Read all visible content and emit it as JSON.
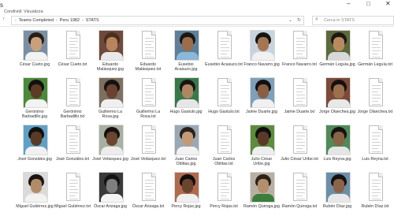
{
  "window": {
    "menu": [
      "Condividi",
      "Visualizza"
    ],
    "controls": [
      "–",
      "□",
      "✕"
    ]
  },
  "address": {
    "crumbs": [
      "Teams Completed",
      "Peru 1982",
      "STATS"
    ],
    "search_placeholder": "Cerca in STATS"
  },
  "files": [
    {
      "label": "César Cueto.jpg",
      "type": "photo",
      "skin": "#c9a07a",
      "hair": "#2a1e16",
      "shirt": "#f2f2f2",
      "bg": "#7a8fa3"
    },
    {
      "label": "César Cueto.txt",
      "type": "txt"
    },
    {
      "label": "Eduardo Malásquez.jpg",
      "type": "photo",
      "skin": "#b8845e",
      "hair": "#4a2e1e",
      "shirt": "#e9e9e9",
      "bg": "#6d4a3c"
    },
    {
      "label": "Eduardo Malásquez.txt",
      "type": "txt"
    },
    {
      "label": "Eusebio Acasuzo.jpg",
      "type": "photo",
      "skin": "#9b6d4c",
      "hair": "#1b1714",
      "shirt": "#8bb7d8",
      "bg": "#5d7f9a"
    },
    {
      "label": "Eusebio Acasuzo.txt",
      "type": "txt"
    },
    {
      "label": "Franco Navarro.jpg",
      "type": "photo",
      "skin": "#a57652",
      "hair": "#141414",
      "shirt": "#f1f1f1",
      "bg": "#c7d3dd"
    },
    {
      "label": "Franco Navarro.txt",
      "type": "txt"
    },
    {
      "label": "Germán Leguía.jpg",
      "type": "photo",
      "skin": "#b88a5f",
      "hair": "#1d1812",
      "shirt": "#d8d8d8",
      "bg": "#5b6a3b"
    },
    {
      "label": "Germán Leguía.txt",
      "type": "txt"
    },
    {
      "label": "Gerónimo Barbadillo.jpg",
      "type": "photo",
      "skin": "#5e3b26",
      "hair": "#141010",
      "shirt": "#f3f3f3",
      "bg": "#4a8a38"
    },
    {
      "label": "Gerónimo Barbadillo.txt",
      "type": "txt"
    },
    {
      "label": "Guillermo La Rosa.jpg",
      "type": "photo",
      "skin": "#6a4330",
      "hair": "#161211",
      "shirt": "#efefef",
      "bg": "#7e705f"
    },
    {
      "label": "Guillermo La Rosa.txt",
      "type": "txt"
    },
    {
      "label": "Hugo Gastulo.jpg",
      "type": "photo",
      "skin": "#b08563",
      "hair": "#1a1512",
      "shirt": "#e6e6e6",
      "bg": "#38794a"
    },
    {
      "label": "Hugo Gastulo.txt",
      "type": "txt"
    },
    {
      "label": "Jaime Duarte.jpg",
      "type": "photo",
      "skin": "#8a5e42",
      "hair": "#121010",
      "shirt": "#f0f0f0",
      "bg": "#7ea0b8"
    },
    {
      "label": "Jaime Duarte.txt",
      "type": "txt"
    },
    {
      "label": "Jorge Olaechea.jpg",
      "type": "photo",
      "skin": "#9c6f4d",
      "hair": "#151110",
      "shirt": "#e8e8e8",
      "bg": "#7d4a3a"
    },
    {
      "label": "Jorge Olaechea.txt",
      "type": "txt"
    },
    {
      "label": "José Gonzáles.jpg",
      "type": "photo",
      "skin": "#5a3a26",
      "hair": "#121010",
      "shirt": "#f1f1f1",
      "bg": "#5fa0c6"
    },
    {
      "label": "José Gonzáles.txt",
      "type": "txt"
    },
    {
      "label": "José Velásquez.jpg",
      "type": "photo",
      "skin": "#6b4530",
      "hair": "#141110",
      "shirt": "#ececec",
      "bg": "#a8b0a2"
    },
    {
      "label": "José Velásquez.txt",
      "type": "txt"
    },
    {
      "label": "Juan Carlos Oblitas.jpg",
      "type": "photo",
      "skin": "#c29a78",
      "hair": "#2a211b",
      "shirt": "#f2f2f2",
      "bg": "#9aa8b4"
    },
    {
      "label": "Juan Carlos Oblitas.txt",
      "type": "txt"
    },
    {
      "label": "Julio César Uribe.jpg",
      "type": "photo",
      "skin": "#5b3b28",
      "hair": "#101010",
      "shirt": "#eeeeee",
      "bg": "#5d8c3e"
    },
    {
      "label": "Julio César Uribe.txt",
      "type": "txt"
    },
    {
      "label": "Luis Reyna.jpg",
      "type": "photo",
      "skin": "#8a6246",
      "hair": "#151211",
      "shirt": "#e5e5e5",
      "bg": "#4f8a58"
    },
    {
      "label": "Luis Reyna.txt",
      "type": "txt"
    },
    {
      "label": "Miguel Gutiérrez.jpg",
      "type": "photo",
      "skin": "#b28b68",
      "hair": "#1b1613",
      "shirt": "#f2f2f2",
      "bg": "#dadada"
    },
    {
      "label": "Miguel Gutiérrez.txt",
      "type": "txt"
    },
    {
      "label": "Óscar Arizaga.jpg",
      "type": "photo",
      "skin": "#7e7e7e",
      "hair": "#141414",
      "shirt": "#f4f4f4",
      "bg": "#3a3a3a"
    },
    {
      "label": "Óscar Arizaga.txt",
      "type": "txt"
    },
    {
      "label": "Percy Rojas.jpg",
      "type": "photo",
      "skin": "#6b4430",
      "hair": "#120f0e",
      "shirt": "#efefef",
      "bg": "#b06a4d"
    },
    {
      "label": "Percy Rojas.txt",
      "type": "txt"
    },
    {
      "label": "Ramón Quiroga.jpg",
      "type": "photo",
      "skin": "#b48f6d",
      "hair": "#2b2219",
      "shirt": "#3c7d3b",
      "bg": "#b8b0a2"
    },
    {
      "label": "Ramón Quiroga.txt",
      "type": "txt"
    },
    {
      "label": "Rubén Díaz.jpg",
      "type": "photo",
      "skin": "#8c6448",
      "hair": "#151211",
      "shirt": "#e8e8e8",
      "bg": "#6b8fa8"
    },
    {
      "label": "Rubén Díaz.txt",
      "type": "txt"
    }
  ]
}
